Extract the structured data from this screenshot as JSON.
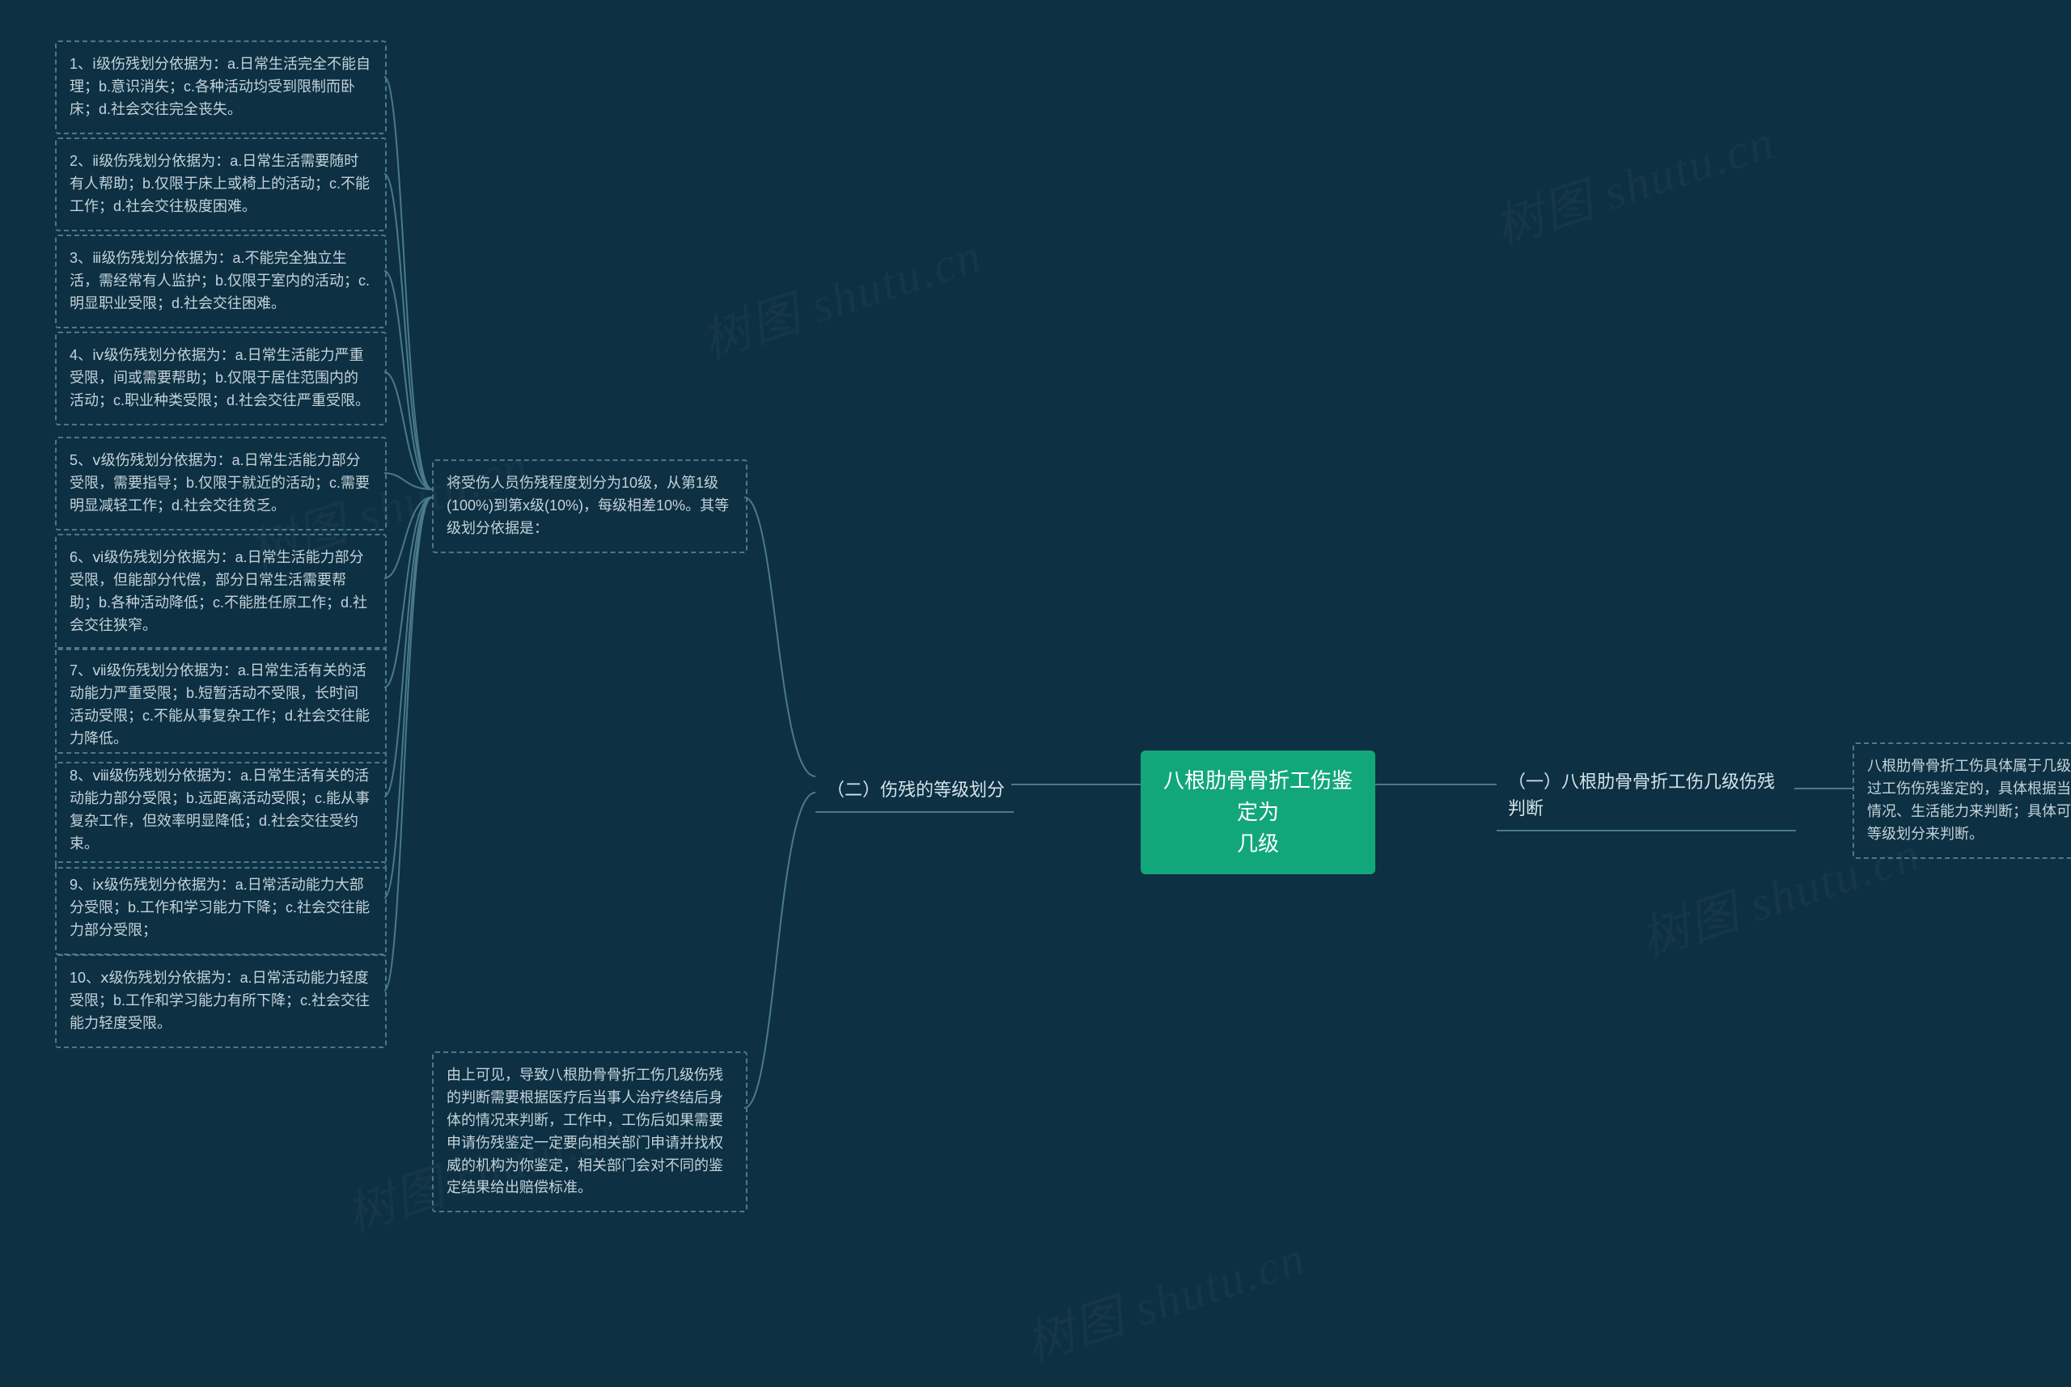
{
  "root": {
    "title": "八根肋骨骨折工伤鉴定为\n几级"
  },
  "right_branch": {
    "label": "（一）八根肋骨骨折工伤几级伤残\n判断",
    "leaf": "八根肋骨骨折工伤具体属于几级伤残是要通过工伤伤残鉴定的，具体根据当事人的身体情况、生活能力来判断；具体可以参考伤残等级划分来判断。"
  },
  "left_branch": {
    "label": "（二）伤残的等级划分",
    "intro": "将受伤人员伤残程度划分为10级，从第1级(100%)到第x级(10%)，每级相差10%。其等级划分依据是：",
    "levels": [
      "1、ⅰ级伤残划分依据为：a.日常生活完全不能自理；b.意识消失；c.各种活动均受到限制而卧床；d.社会交往完全丧失。",
      "2、ⅱ级伤残划分依据为：a.日常生活需要随时有人帮助；b.仅限于床上或椅上的活动；c.不能工作；d.社会交往极度困难。",
      "3、ⅲ级伤残划分依据为：a.不能完全独立生活，需经常有人监护；b.仅限于室内的活动；c.明显职业受限；d.社会交往困难。",
      "4、ⅳ级伤残划分依据为：a.日常生活能力严重受限，间或需要帮助；b.仅限于居住范围内的活动；c.职业种类受限；d.社会交往严重受限。",
      "5、ⅴ级伤残划分依据为：a.日常生活能力部分受限，需要指导；b.仅限于就近的活动；c.需要明显减轻工作；d.社会交往贫乏。",
      "6、ⅵ级伤残划分依据为：a.日常生活能力部分受限，但能部分代偿，部分日常生活需要帮助；b.各种活动降低；c.不能胜任原工作；d.社会交往狭窄。",
      "7、ⅶ级伤残划分依据为：a.日常生活有关的活动能力严重受限；b.短暂活动不受限，长时间活动受限；c.不能从事复杂工作；d.社会交往能力降低。",
      "8、ⅷ级伤残划分依据为：a.日常生活有关的活动能力部分受限；b.远距离活动受限；c.能从事复杂工作，但效率明显降低；d.社会交往受约束。",
      "9、ⅸ级伤残划分依据为：a.日常活动能力大部分受限；b.工作和学习能力下降；c.社会交往能力部分受限；",
      "10、ⅹ级伤残划分依据为：a.日常活动能力轻度受限；b.工作和学习能力有所下降；c.社会交往能力轻度受限。"
    ],
    "summary": "由上可见，导致八根肋骨骨折工伤几级伤残的判断需要根据医疗后当事人治疗终结后身体的情况来判断，工作中，工伤后如果需要申请伤残鉴定一定要向相关部门申请并找权威的机构为你鉴定，相关部门会对不同的鉴定结果给出赔偿标准。"
  },
  "watermark": "树图 shutu.cn"
}
